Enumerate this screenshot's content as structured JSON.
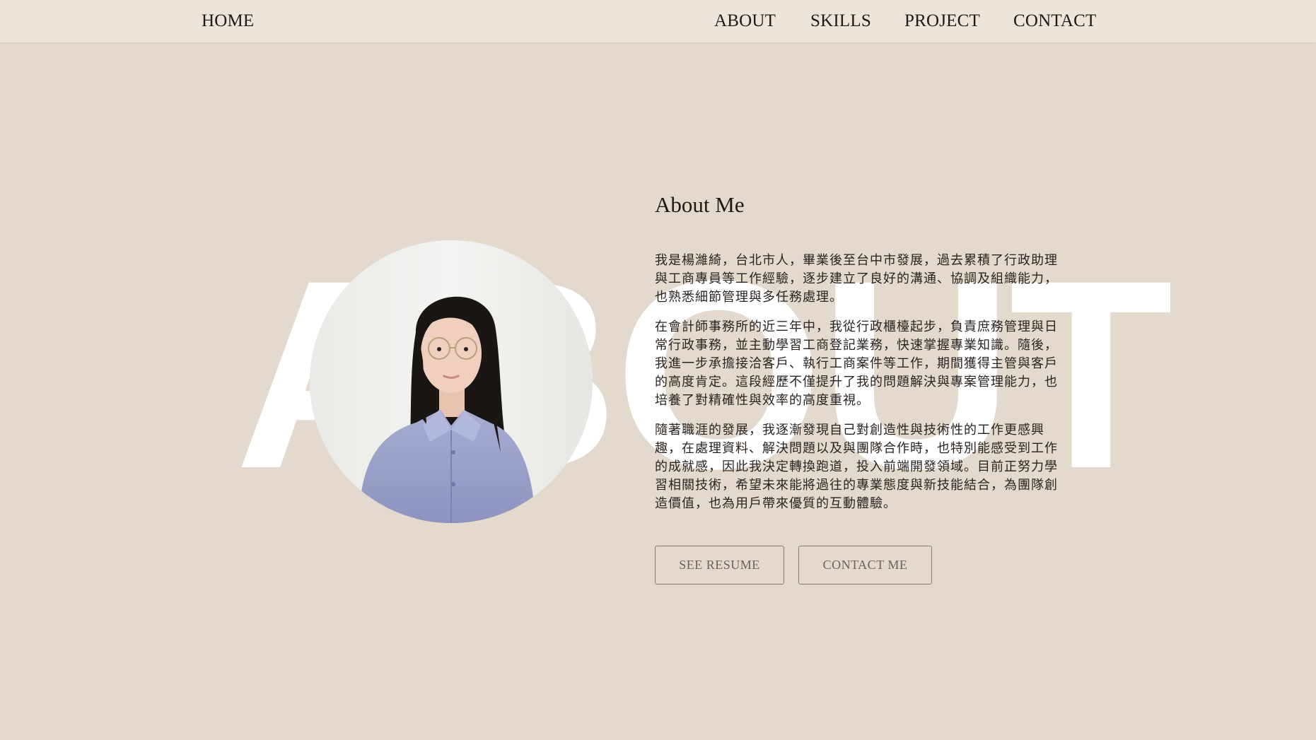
{
  "nav": {
    "home": "HOME",
    "about": "ABOUT",
    "skills": "SKILLS",
    "project": "PROJECT",
    "contact": "CONTACT"
  },
  "hero": {
    "bg_word": "ABOUT",
    "title": "About Me",
    "paragraphs": [
      "我是楊濰綺，台北市人，畢業後至台中市發展，過去累積了行政助理與工商專員等工作經驗，逐步建立了良好的溝通、協調及組織能力，也熟悉細節管理與多任務處理。",
      "在會計師事務所的近三年中，我從行政櫃檯起步，負責庶務管理與日常行政事務，並主動學習工商登記業務，快速掌握專業知識。隨後，我進一步承擔接洽客戶、執行工商案件等工作，期間獲得主管與客戶的高度肯定。這段經歷不僅提升了我的問題解決與專案管理能力，也培養了對精確性與效率的高度重視。",
      "隨著職涯的發展，我逐漸發現自己對創造性與技術性的工作更感興趣，在處理資料、解決問題以及與團隊合作時，也特別能感受到工作的成就感，因此我決定轉換跑道，投入前端開發領域。目前正努力學習相關技術，希望未來能將過往的專業態度與新技能結合，為團隊創造價值，也為用戶帶來優質的互動體驗。"
    ],
    "btn_resume": "SEE RESUME",
    "btn_contact": "CONTACT ME"
  },
  "colors": {
    "page_bg": "#e3d9cc",
    "navbar_bg": "#ede4da",
    "bg_word": "#ffffff",
    "button_border": "#8a7d70",
    "button_text": "#6e6256"
  }
}
